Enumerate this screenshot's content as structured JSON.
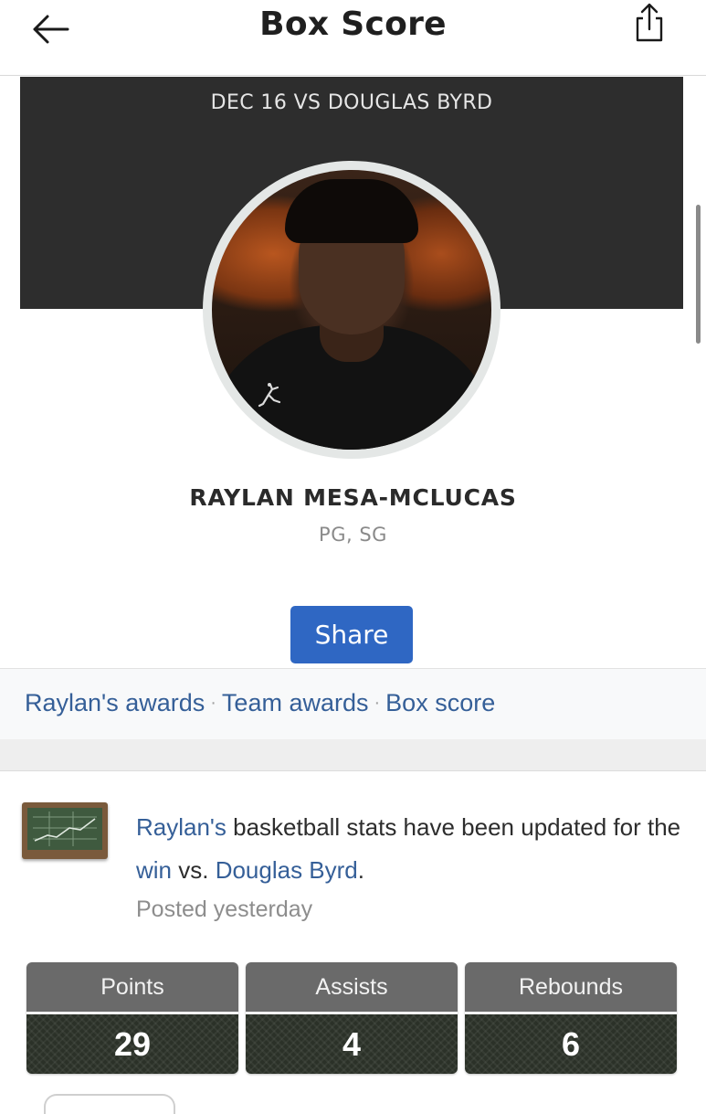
{
  "header": {
    "title": "Box Score",
    "back_icon": "arrow-left-icon",
    "share_icon": "share-upload-icon"
  },
  "hero": {
    "game_label": "DEC 16 VS DOUGLAS BYRD",
    "player_name": "RAYLAN MESA-MCLUCAS",
    "positions": "PG, SG",
    "share_label": "Share"
  },
  "links": {
    "items": [
      "Raylan's awards",
      "Team awards",
      "Box score"
    ],
    "separator": "·"
  },
  "post": {
    "icon": "chalkboard-stats-icon",
    "player_link": "Raylan's",
    "text_1": " basketball stats have been updated for the ",
    "result_link": "win",
    "text_2": " vs. ",
    "opponent_link": "Douglas Byrd",
    "text_3": ".",
    "time": "Posted yesterday"
  },
  "stats": [
    {
      "label": "Points",
      "value": "29"
    },
    {
      "label": "Assists",
      "value": "4"
    },
    {
      "label": "Rebounds",
      "value": "6"
    }
  ],
  "colors": {
    "accent": "#2f67c3",
    "link": "#355f98",
    "hero_bg": "#2d2d2d",
    "stat_header": "#6a6a6a",
    "stat_value_bg": "#2b3128"
  }
}
